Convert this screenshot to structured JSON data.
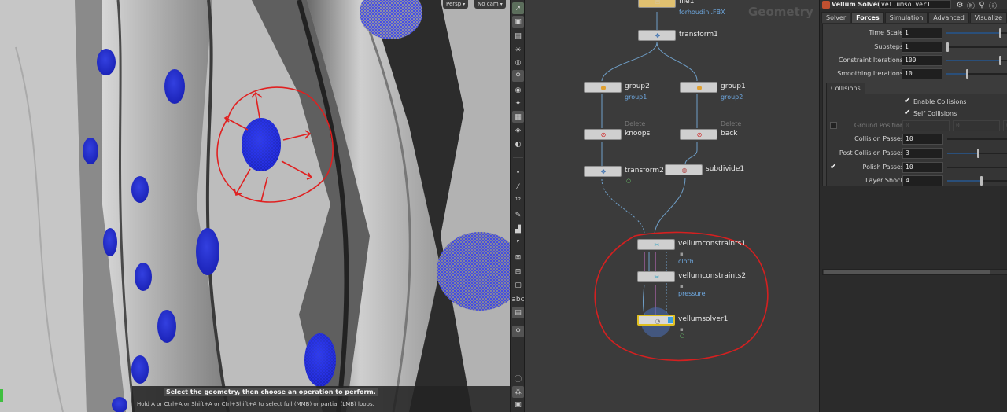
{
  "viewport": {
    "persp_label": "Persp",
    "camera_label": "No cam",
    "status_prompt": "Select the geometry, then choose an operation to perform.",
    "status_hint": "Hold A or Ctrl+A or Shift+A or Ctrl+Shift+A to select full (MMB) or partial (LMB) loops."
  },
  "toolbar": {
    "icons": [
      "select-arrow-icon",
      "view-icon",
      "lock-icon",
      "light-icon",
      "camera-icon",
      "pin-icon",
      "snap-icon",
      "grid-icon",
      "display-icon",
      "wire-icon",
      "dot-icon",
      "measure-icon",
      "count-icon",
      "quick-icon",
      "brush-icon",
      "guide-icon",
      "frame-icon",
      "group-icon",
      "box-icon",
      "text-icon",
      "visualizer-icon",
      "info-icon",
      "network-icon",
      "render-icon"
    ]
  },
  "network": {
    "context_title": "Geometry",
    "nodes": {
      "file1": {
        "name": "file1",
        "sub": "forhoudini.FBX"
      },
      "transform1": {
        "name": "transform1"
      },
      "group2": {
        "name": "group2",
        "sub": "group1"
      },
      "group1": {
        "name": "group1",
        "sub": "group2"
      },
      "knoops": {
        "name": "knoops",
        "upper": "Delete"
      },
      "back": {
        "name": "back",
        "upper": "Delete"
      },
      "transform2": {
        "name": "transform2"
      },
      "subdivide1": {
        "name": "subdivide1"
      },
      "vellumconstraints1": {
        "name": "vellumconstraints1",
        "sub": "cloth"
      },
      "vellumconstraints2": {
        "name": "vellumconstraints2",
        "sub": "pressure"
      },
      "vellumsolver1": {
        "name": "vellumsolver1"
      }
    }
  },
  "params": {
    "node_type": "Vellum Solver",
    "node_name": "vellumsolver1",
    "tabs": [
      "Solver",
      "Forces",
      "Simulation",
      "Advanced",
      "Visualize"
    ],
    "active_tab": "Forces",
    "rows": [
      {
        "label": "Time Scale",
        "value": "1",
        "fill": 0.88
      },
      {
        "label": "Substeps",
        "value": "1",
        "fill": 0.0
      },
      {
        "label": "Constraint Iterations",
        "value": "100",
        "fill": 0.88
      },
      {
        "label": "Smoothing Iterations",
        "value": "10",
        "fill": 0.33
      }
    ],
    "collisions_tab": "Collisions",
    "enable_collisions": "Enable Collisions",
    "self_collisions": "Self Collisions",
    "ground_position": {
      "label": "Ground Position",
      "values": [
        "0",
        "0",
        "0"
      ]
    },
    "coll_rows": [
      {
        "label": "Collision Passes",
        "value": "10",
        "fill": 0.0
      },
      {
        "label": "Post Collision Passes",
        "value": "3",
        "fill": 0.5
      },
      {
        "label": "Polish Passes",
        "value": "10",
        "fill": 0.0
      },
      {
        "label": "Layer Shock",
        "value": "4",
        "fill": 0.55
      }
    ]
  }
}
